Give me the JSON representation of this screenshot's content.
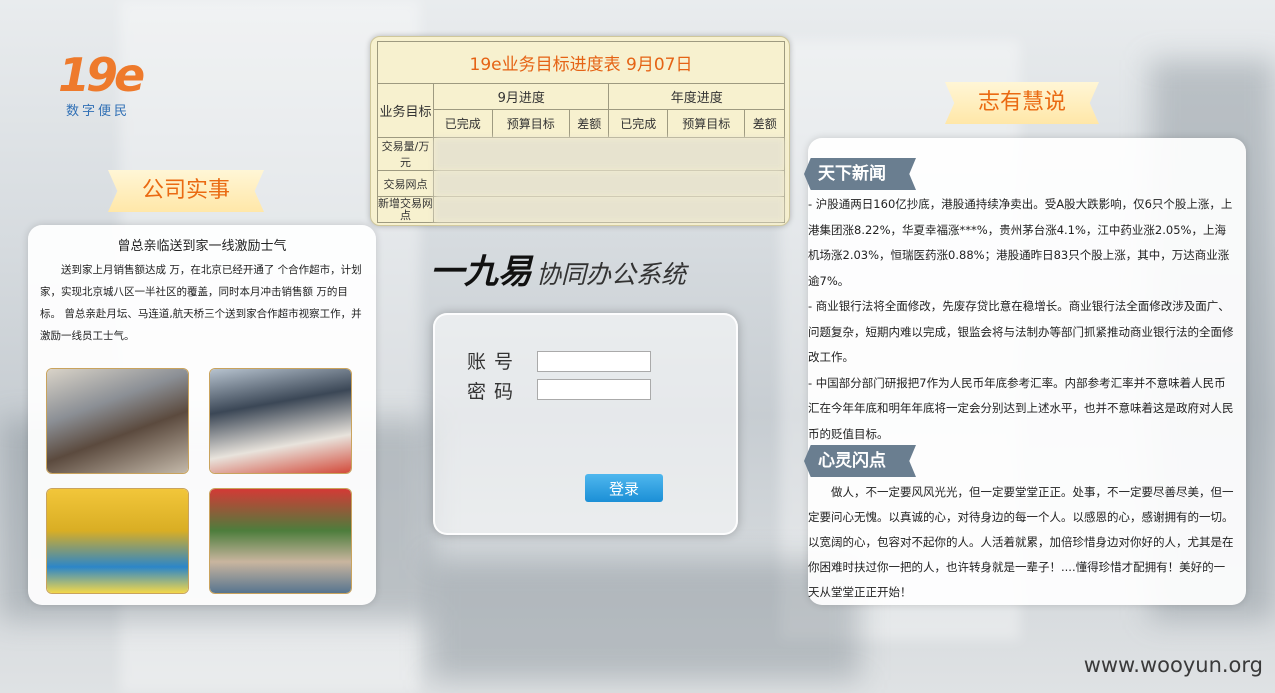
{
  "logo": {
    "mark": "19e",
    "subtitle": "数字便民"
  },
  "company": {
    "title": "公司实事",
    "headline": "曾总亲临送到家一线激励士气",
    "body": "送到家上月销售额达成 万，在北京已经开通了 个合作超市，计划 家，实现北京城八区一半社区的覆盖，同时本月冲击销售额 万的目标。 曾总亲赴月坛、马连道,航天桥三个送到家合作超市视察工作，并激励一线员工士气。",
    "photos": [
      "photo-1",
      "photo-2",
      "photo-3",
      "photo-4"
    ]
  },
  "progress": {
    "title": "19e业务目标进度表   9月07日",
    "col_target": "业务目标",
    "col_month": "9月进度",
    "col_year": "年度进度",
    "sub_headers": [
      "已完成",
      "预算目标",
      "差额",
      "已完成",
      "预算目标",
      "差额"
    ],
    "rows": [
      "交易量/万元",
      "交易网点",
      "新增交易网点"
    ]
  },
  "system": {
    "title_big": "一九易",
    "title_small": "协同办公系统"
  },
  "login": {
    "account_label": "账号",
    "password_label": "密码",
    "account_value": "",
    "password_value": "",
    "button": "登录"
  },
  "right": {
    "title": "志有慧说",
    "news_tag": "天下新闻",
    "news": [
      "-  沪股通两日160亿抄底，港股通持续净卖出。受A股大跌影响，仅6只个股上涨，上港集团涨8.22%，华夏幸福涨***%，贵州茅台涨4.1%，江中药业涨2.05%，上海机场涨2.03%，恒瑞医药涨0.88%；港股通昨日83只个股上涨，其中，万达商业涨逾7%。",
      "-  商业银行法将全面修改，先废存贷比意在稳增长。商业银行法全面修改涉及面广、问题复杂，短期内难以完成，银监会将与法制办等部门抓紧推动商业银行法的全面修改工作。",
      "-  中国部分部门研报把7作为人民币年底参考汇率。内部参考汇率并不意味着人民币汇在今年年底和明年年底将一定会分别达到上述水平，也并不意味着这是政府对人民币的贬值目标。"
    ],
    "heart_tag": "心灵闪点",
    "heart": "做人，不一定要风风光光，但一定要堂堂正正。处事，不一定要尽善尽美，但一定要问心无愧。以真诚的心，对待身边的每一个人。以感恩的心，感谢拥有的一切。以宽阔的心，包容对不起你的人。人活着就累，加倍珍惜身边对你好的人，尤其是在你困难时扶过你一把的人，也许转身就是一辈子！....懂得珍惜才配拥有！美好的一天从堂堂正正开始！"
  },
  "watermark": "www.wooyun.org"
}
